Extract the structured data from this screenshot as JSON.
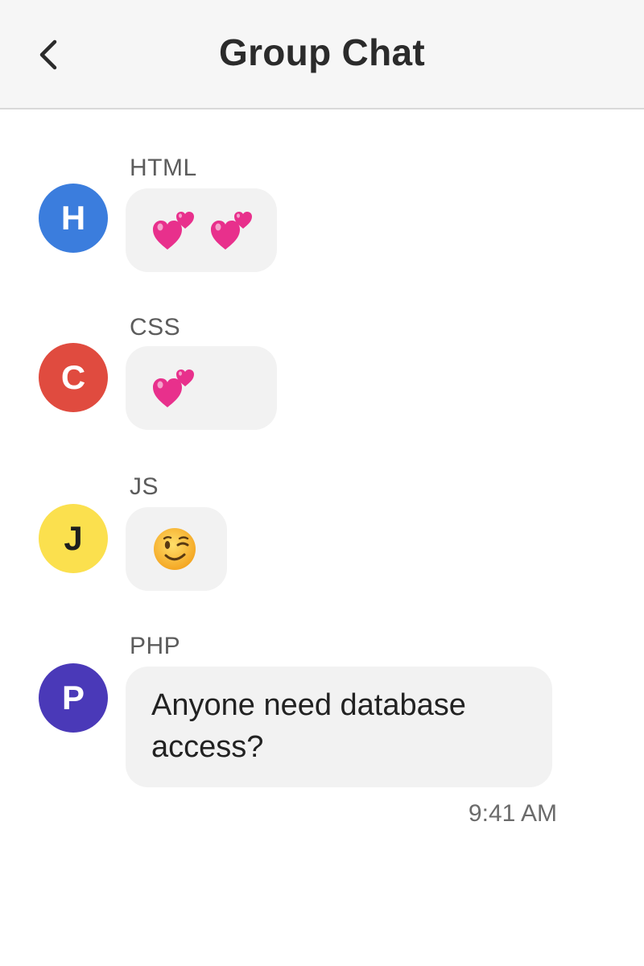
{
  "header": {
    "title": "Group Chat",
    "back_icon": "chevron-left-icon"
  },
  "messages": [
    {
      "sender": "HTML",
      "avatar_letter": "H",
      "avatar_color": "#3b7ddd",
      "avatar_text_color": "#ffffff",
      "content_type": "emoji",
      "emojis": [
        "two-hearts-emoji",
        "two-hearts-emoji"
      ]
    },
    {
      "sender": "CSS",
      "avatar_letter": "C",
      "avatar_color": "#e04b3f",
      "avatar_text_color": "#ffffff",
      "content_type": "emoji",
      "emojis": [
        "two-hearts-emoji"
      ]
    },
    {
      "sender": "JS",
      "avatar_letter": "J",
      "avatar_color": "#fbe04e",
      "avatar_text_color": "#1e1e1e",
      "content_type": "emoji",
      "emojis": [
        "winking-face-emoji"
      ]
    },
    {
      "sender": "PHP",
      "avatar_letter": "P",
      "avatar_color": "#4a39b8",
      "avatar_text_color": "#ffffff",
      "content_type": "text",
      "text": "Anyone need database access?"
    }
  ],
  "timestamp": "9:41 AM"
}
